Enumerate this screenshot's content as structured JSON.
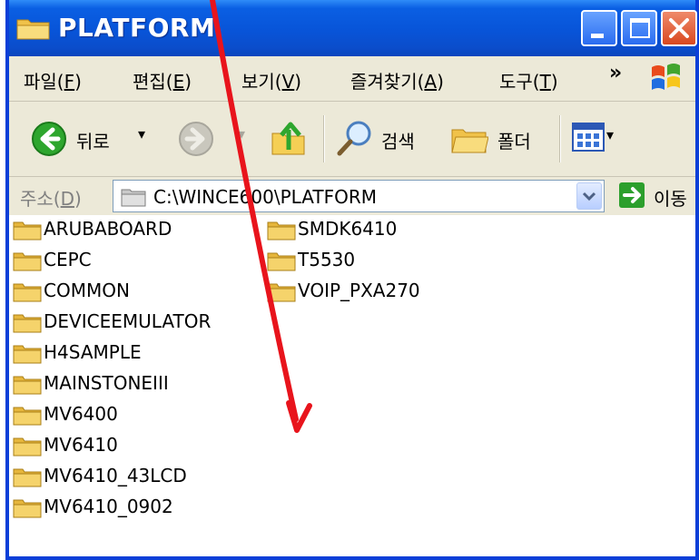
{
  "window": {
    "title": "PLATFORM"
  },
  "menu": {
    "file": "파일(",
    "file_key": "F",
    "edit": "편집(",
    "edit_key": "E",
    "view": "보기(",
    "view_key": "V",
    "favorites": "즐겨찾기(",
    "favorites_key": "A",
    "tools": "도구(",
    "tools_key": "T",
    "close_paren": ")",
    "more": "»"
  },
  "toolbar": {
    "back_label": "뒤로",
    "search_label": "검색",
    "folders_label": "폴더"
  },
  "address": {
    "label": "주소(",
    "label_key": "D",
    "label_close": ")",
    "path": "C:\\WINCE600\\PLATFORM",
    "go_label": "이동"
  },
  "files": {
    "col1": [
      "ARUBABOARD",
      "CEPC",
      "COMMON",
      "DEVICEEMULATOR",
      "H4SAMPLE",
      "MAINSTONEIII",
      "MV6400",
      "MV6410",
      "MV6410_43LCD",
      "MV6410_0902"
    ],
    "col2": [
      "SMDK6410",
      "T5530",
      "VOIP_PXA270"
    ]
  },
  "colors": {
    "titlebar": "#0854d8",
    "folder": "#f5d36b",
    "annotation_arrow": "#e8141c"
  }
}
